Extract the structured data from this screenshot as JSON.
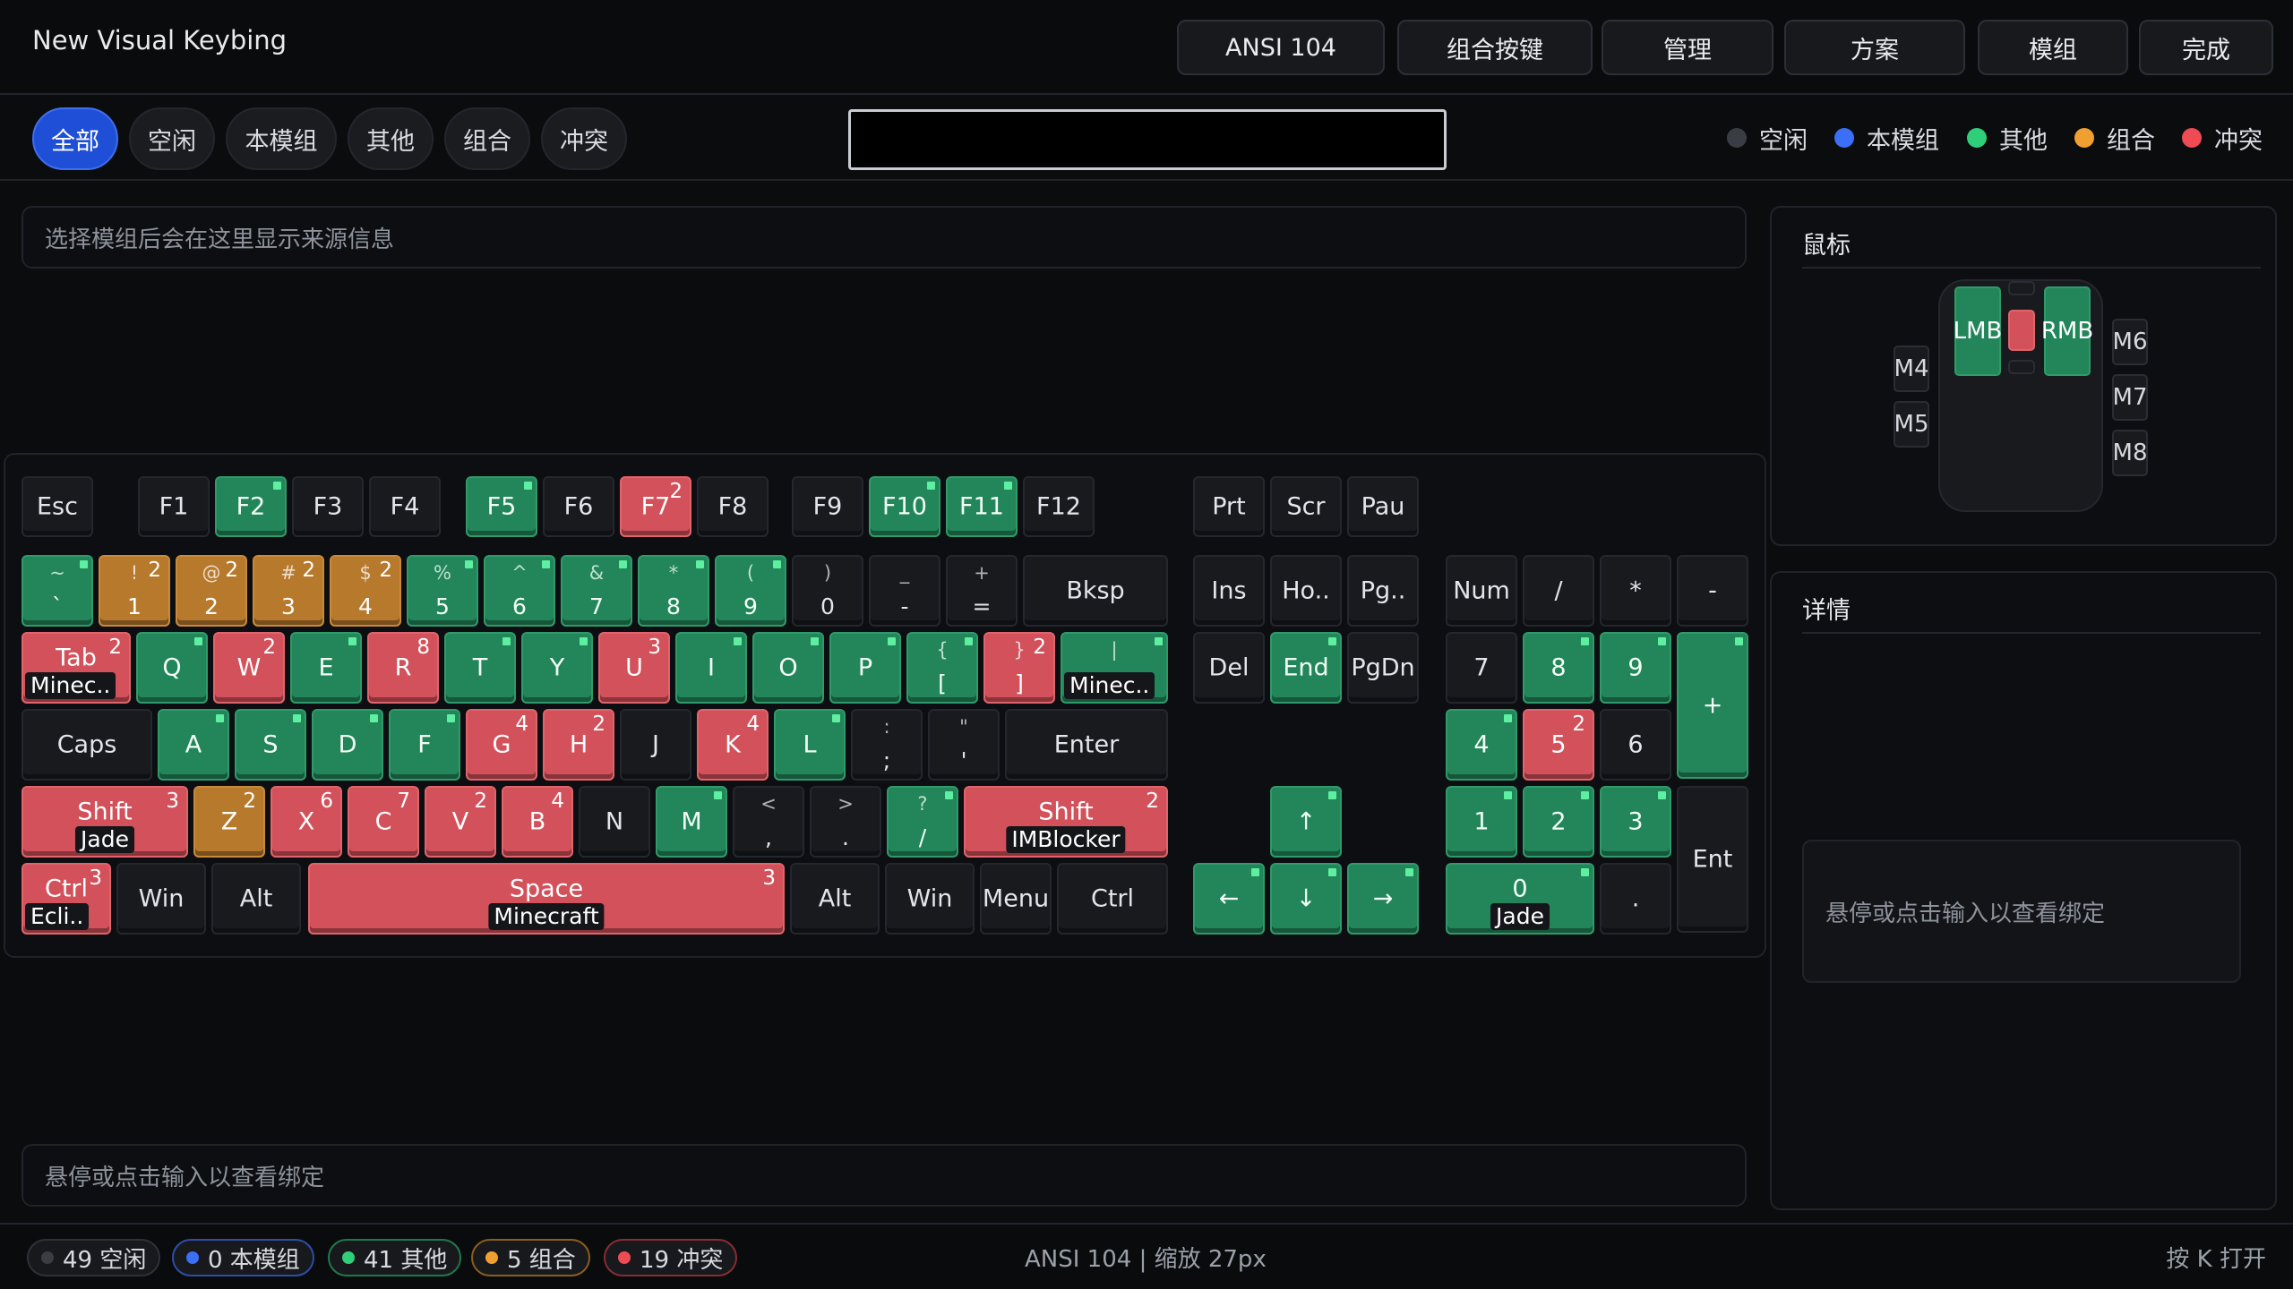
{
  "header": {
    "title": "New Visual Keybing",
    "buttons": [
      "ANSI 104",
      "组合按键",
      "管理",
      "方案",
      "模组",
      "完成"
    ]
  },
  "filters": {
    "pills": [
      "全部",
      "空闲",
      "本模组",
      "其他",
      "组合",
      "冲突"
    ],
    "active": "全部",
    "search_value": ""
  },
  "legend": [
    {
      "label": "空闲",
      "color": "#3a3d44"
    },
    {
      "label": "本模组",
      "color": "#3b6ff5"
    },
    {
      "label": "其他",
      "color": "#2fcf7a"
    },
    {
      "label": "组合",
      "color": "#f0a030"
    },
    {
      "label": "冲突",
      "color": "#ef4b55"
    }
  ],
  "source_info": "选择模组后会在这里显示来源信息",
  "hover_hint": "悬停或点击输入以查看绑定",
  "colors": {
    "free": "#181a1e",
    "other": "#23855a",
    "conflict": "#d2515a",
    "combo": "#b7792c"
  },
  "keys": [
    {
      "main": "Esc",
      "state": "free"
    },
    {
      "main": "F1",
      "state": "free"
    },
    {
      "main": "F2",
      "state": "other"
    },
    {
      "main": "F3",
      "state": "free"
    },
    {
      "main": "F4",
      "state": "free"
    },
    {
      "main": "F5",
      "state": "other"
    },
    {
      "main": "F6",
      "state": "free"
    },
    {
      "main": "F7",
      "state": "conflict",
      "count": "2"
    },
    {
      "main": "F8",
      "state": "free"
    },
    {
      "main": "F9",
      "state": "free"
    },
    {
      "main": "F10",
      "state": "other"
    },
    {
      "main": "F11",
      "state": "other"
    },
    {
      "main": "F12",
      "state": "free"
    },
    {
      "main": "Prt",
      "state": "free"
    },
    {
      "main": "Scr",
      "state": "free"
    },
    {
      "main": "Pau",
      "state": "free"
    },
    {
      "sym": "~",
      "main": "`",
      "state": "other"
    },
    {
      "sym": "!",
      "main": "1",
      "state": "combo",
      "count": "2"
    },
    {
      "sym": "@",
      "main": "2",
      "state": "combo",
      "count": "2"
    },
    {
      "sym": "#",
      "main": "3",
      "state": "combo",
      "count": "2"
    },
    {
      "sym": "$",
      "main": "4",
      "state": "combo",
      "count": "2"
    },
    {
      "sym": "%",
      "main": "5",
      "state": "other"
    },
    {
      "sym": "^",
      "main": "6",
      "state": "other"
    },
    {
      "sym": "&",
      "main": "7",
      "state": "other"
    },
    {
      "sym": "*",
      "main": "8",
      "state": "other"
    },
    {
      "sym": "(",
      "main": "9",
      "state": "other"
    },
    {
      "sym": ")",
      "main": "0",
      "state": "free"
    },
    {
      "sym": "_",
      "main": "-",
      "state": "free"
    },
    {
      "sym": "+",
      "main": "=",
      "state": "free"
    },
    {
      "main": "Bksp",
      "state": "free"
    },
    {
      "main": "Ins",
      "state": "free"
    },
    {
      "main": "Ho..",
      "state": "free"
    },
    {
      "main": "Pg..",
      "state": "free"
    },
    {
      "main": "Num",
      "state": "free"
    },
    {
      "main": "/",
      "state": "free"
    },
    {
      "main": "*",
      "state": "free"
    },
    {
      "main": "-",
      "state": "free"
    },
    {
      "main": "Tab",
      "state": "conflict",
      "count": "2",
      "sub": "Minec.."
    },
    {
      "main": "Q",
      "state": "other"
    },
    {
      "main": "W",
      "state": "conflict",
      "count": "2"
    },
    {
      "main": "E",
      "state": "other"
    },
    {
      "main": "R",
      "state": "conflict",
      "count": "8"
    },
    {
      "main": "T",
      "state": "other"
    },
    {
      "main": "Y",
      "state": "other"
    },
    {
      "main": "U",
      "state": "conflict",
      "count": "3"
    },
    {
      "main": "I",
      "state": "other"
    },
    {
      "main": "O",
      "state": "other"
    },
    {
      "main": "P",
      "state": "other"
    },
    {
      "sym": "{",
      "main": "[",
      "state": "other"
    },
    {
      "sym": "}",
      "main": "]",
      "state": "conflict",
      "count": "2"
    },
    {
      "sym": "|",
      "main": "",
      "state": "other",
      "sub": "Minec.."
    },
    {
      "main": "Del",
      "state": "free"
    },
    {
      "main": "End",
      "state": "other"
    },
    {
      "main": "PgDn",
      "state": "free"
    },
    {
      "main": "7",
      "state": "free"
    },
    {
      "main": "8",
      "state": "other"
    },
    {
      "main": "9",
      "state": "other"
    },
    {
      "main": "+",
      "state": "other"
    },
    {
      "main": "Caps",
      "state": "free"
    },
    {
      "main": "A",
      "state": "other"
    },
    {
      "main": "S",
      "state": "other"
    },
    {
      "main": "D",
      "state": "other"
    },
    {
      "main": "F",
      "state": "other"
    },
    {
      "main": "G",
      "state": "conflict",
      "count": "4"
    },
    {
      "main": "H",
      "state": "conflict",
      "count": "2"
    },
    {
      "main": "J",
      "state": "free"
    },
    {
      "main": "K",
      "state": "conflict",
      "count": "4"
    },
    {
      "main": "L",
      "state": "other"
    },
    {
      "sym": ":",
      "main": ";",
      "state": "free"
    },
    {
      "sym": "\"",
      "main": "'",
      "state": "free"
    },
    {
      "main": "Enter",
      "state": "free"
    },
    {
      "main": "4",
      "state": "other"
    },
    {
      "main": "5",
      "state": "conflict",
      "count": "2"
    },
    {
      "main": "6",
      "state": "free"
    },
    {
      "main": "Shift",
      "state": "conflict",
      "count": "3",
      "sub": "Jade"
    },
    {
      "main": "Z",
      "state": "combo",
      "count": "2"
    },
    {
      "main": "X",
      "state": "conflict",
      "count": "6"
    },
    {
      "main": "C",
      "state": "conflict",
      "count": "7"
    },
    {
      "main": "V",
      "state": "conflict",
      "count": "2"
    },
    {
      "main": "B",
      "state": "conflict",
      "count": "4"
    },
    {
      "main": "N",
      "state": "free"
    },
    {
      "main": "M",
      "state": "other"
    },
    {
      "sym": "<",
      "main": ",",
      "state": "free"
    },
    {
      "sym": ">",
      "main": ".",
      "state": "free"
    },
    {
      "sym": "?",
      "main": "/",
      "state": "other"
    },
    {
      "main": "Shift",
      "state": "conflict",
      "count": "2",
      "sub": "IMBlocker"
    },
    {
      "main": "↑",
      "state": "other"
    },
    {
      "main": "1",
      "state": "other"
    },
    {
      "main": "2",
      "state": "other"
    },
    {
      "main": "3",
      "state": "other"
    },
    {
      "main": "Ent",
      "state": "free"
    },
    {
      "main": "Ctrl",
      "state": "conflict",
      "count": "3",
      "sub": "Ecli.."
    },
    {
      "main": "Win",
      "state": "free"
    },
    {
      "main": "Alt",
      "state": "free"
    },
    {
      "main": "Space",
      "state": "conflict",
      "count": "3",
      "sub": "Minecraft"
    },
    {
      "main": "Alt",
      "state": "free"
    },
    {
      "main": "Win",
      "state": "free"
    },
    {
      "main": "Menu",
      "state": "free"
    },
    {
      "main": "Ctrl",
      "state": "free"
    },
    {
      "main": "←",
      "state": "other"
    },
    {
      "main": "↓",
      "state": "other"
    },
    {
      "main": "→",
      "state": "other"
    },
    {
      "main": "0",
      "state": "other",
      "sub": "Jade"
    },
    {
      "main": ".",
      "state": "free"
    }
  ],
  "mouse": {
    "title": "鼠标",
    "buttons": [
      {
        "label": "LMB",
        "state": "other"
      },
      {
        "label": "RMB",
        "state": "other"
      },
      {
        "label": "",
        "state": "conflict"
      },
      {
        "label": "M4",
        "state": "free"
      },
      {
        "label": "M5",
        "state": "free"
      },
      {
        "label": "M6",
        "state": "free"
      },
      {
        "label": "M7",
        "state": "free"
      },
      {
        "label": "M8",
        "state": "free"
      }
    ]
  },
  "details": {
    "title": "详情",
    "hint": "悬停或点击输入以查看绑定"
  },
  "status": {
    "badges": [
      {
        "text": "49 空闲",
        "color": "#3a3d44",
        "border": "#2e3137"
      },
      {
        "text": "0 本模组",
        "color": "#3b6ff5",
        "border": "#2d4fa8"
      },
      {
        "text": "41 其他",
        "color": "#2fcf7a",
        "border": "#1e7a4c"
      },
      {
        "text": "5 组合",
        "color": "#f0a030",
        "border": "#8a5e1e"
      },
      {
        "text": "19 冲突",
        "color": "#ef4b55",
        "border": "#8a2c32"
      }
    ],
    "center": "ANSI 104 | 缩放 27px",
    "right": "按 K 打开"
  }
}
